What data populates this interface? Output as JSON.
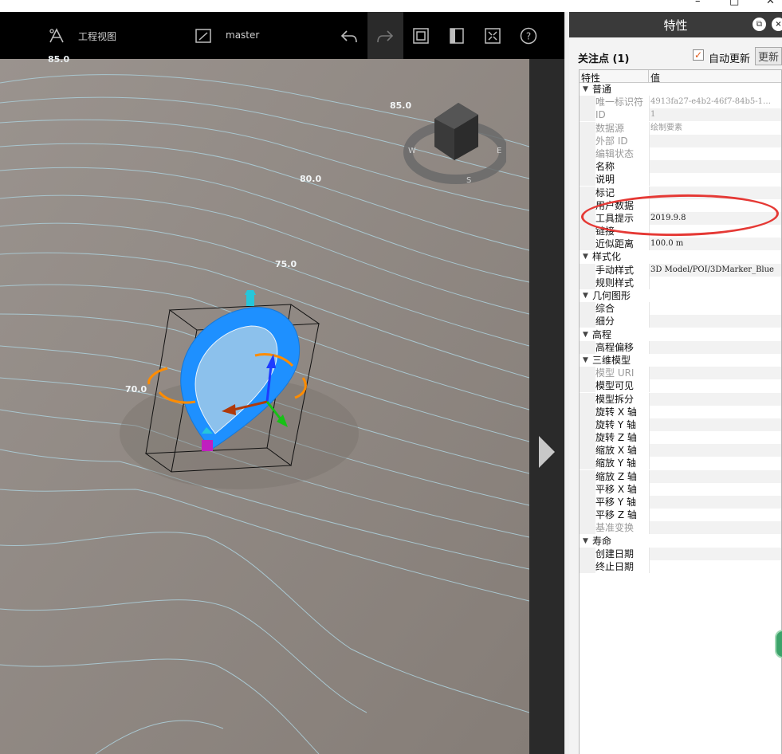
{
  "window_controls": {
    "minimize": "–",
    "restore": "□",
    "close": "✕"
  },
  "viewport": {
    "toolbar": {
      "project_view_label": "工程视图",
      "branch_label": "master"
    },
    "contour_labels": [
      "85.0",
      "85.0",
      "80.0",
      "75.0",
      "70.0"
    ],
    "compass_letters": {
      "left": "W",
      "right": "E",
      "bottom": "S"
    }
  },
  "panel": {
    "title": "特性",
    "focus_label": "关注点 (1)",
    "auto_update_label": "自动更新",
    "auto_update_checked": "✓",
    "update_button": "更新",
    "grid_header": {
      "property": "特性",
      "value": "值"
    },
    "categories": [
      {
        "name": "普通",
        "rows": [
          {
            "name": "唯一标识符",
            "value": "4913fa27-e4b2-46f7-84b5-1…",
            "dim": true
          },
          {
            "name": "ID",
            "value": "1",
            "dim": true
          },
          {
            "name": "数据源",
            "value": "绘制要素",
            "dim": true
          },
          {
            "name": "外部 ID",
            "value": "",
            "dim": true
          },
          {
            "name": "编辑状态",
            "value": "",
            "dim": true
          },
          {
            "name": "名称",
            "value": "",
            "dim": false
          },
          {
            "name": "说明",
            "value": "",
            "dim": false
          },
          {
            "name": "标记",
            "value": "",
            "dim": false
          },
          {
            "name": "用户数据",
            "value": "",
            "dim": false
          },
          {
            "name": "工具提示",
            "value": "2019.9.8",
            "dim": false
          },
          {
            "name": "链接",
            "value": "",
            "dim": false
          },
          {
            "name": "近似距离",
            "value": "100.0 m",
            "dim": false
          }
        ]
      },
      {
        "name": "样式化",
        "rows": [
          {
            "name": "手动样式",
            "value": "3D Model/POI/3DMarker_Blue",
            "dim": false
          },
          {
            "name": "规则样式",
            "value": "",
            "dim": false
          }
        ]
      },
      {
        "name": "几何图形",
        "rows": [
          {
            "name": "综合",
            "value": "",
            "dim": false
          },
          {
            "name": "细分",
            "value": "",
            "dim": false
          }
        ]
      },
      {
        "name": "高程",
        "rows": [
          {
            "name": "高程偏移",
            "value": "",
            "dim": false
          }
        ]
      },
      {
        "name": "三维模型",
        "rows": [
          {
            "name": "模型 URI",
            "value": "",
            "dim": true
          },
          {
            "name": "模型可见",
            "value": "",
            "dim": false
          },
          {
            "name": "模型拆分",
            "value": "",
            "dim": false
          },
          {
            "name": "旋转 X 轴",
            "value": "",
            "dim": false
          },
          {
            "name": "旋转 Y 轴",
            "value": "",
            "dim": false
          },
          {
            "name": "旋转 Z 轴",
            "value": "",
            "dim": false
          },
          {
            "name": "缩放 X 轴",
            "value": "",
            "dim": false
          },
          {
            "name": "缩放 Y 轴",
            "value": "",
            "dim": false
          },
          {
            "name": "缩放 Z 轴",
            "value": "",
            "dim": false
          },
          {
            "name": "平移 X 轴",
            "value": "",
            "dim": false
          },
          {
            "name": "平移 Y 轴",
            "value": "",
            "dim": false
          },
          {
            "name": "平移 Z 轴",
            "value": "",
            "dim": false
          },
          {
            "name": "基准变换",
            "value": "",
            "dim": true
          }
        ]
      },
      {
        "name": "寿命",
        "rows": [
          {
            "name": "创建日期",
            "value": "",
            "dim": false
          },
          {
            "name": "终止日期",
            "value": "",
            "dim": false
          }
        ]
      }
    ]
  },
  "colors": {
    "toolbar_bg": "#000000",
    "terrain": "#8e8781",
    "contour": "#a8c4cc",
    "marker_blue": "#1e90ff",
    "highlight_oval": "#e53935",
    "panel_title_bg": "#3a3a3a"
  }
}
